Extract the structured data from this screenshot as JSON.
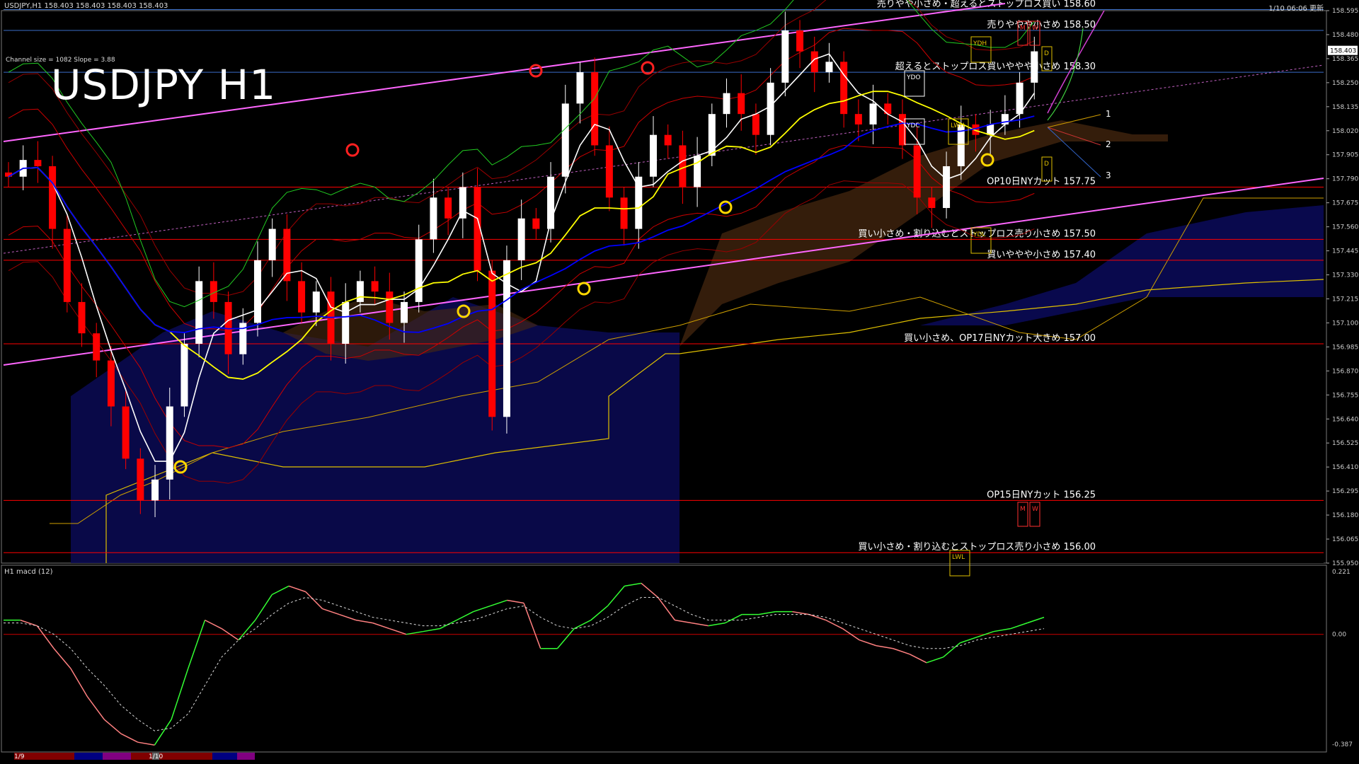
{
  "header": {
    "symbol_info": "USDJPY,H1  158.403 158.403 158.403 158.403",
    "update_time": "1/10 06:06 更新",
    "channel_info": "Channel size = 1082 Slope = 3.88",
    "title": "USDJPY H1",
    "macd_label": "H1  macd (12)"
  },
  "colors": {
    "background": "#000000",
    "bull_candle": "#ffffff",
    "bear_candle": "#ff0000",
    "channel": "#ff66ff",
    "ma_fast": "#ffffff",
    "ma_mid": "#ffff00",
    "ma_slow": "#0000ff",
    "macd_up": "#33ff33",
    "macd_down": "#ff8080",
    "level_line_red": "#ff0000",
    "level_line_blue": "#3a6ec8"
  },
  "chart_data": {
    "type": "candlestick",
    "symbol": "USDJPY",
    "timeframe": "H1",
    "ylim": [
      155.95,
      158.595
    ],
    "y_ticks": [
      "158.595",
      "158.480",
      "158.365",
      "158.250",
      "158.135",
      "158.020",
      "157.905",
      "157.790",
      "157.675",
      "157.560",
      "157.445",
      "157.330",
      "157.215",
      "157.100",
      "156.985",
      "156.870",
      "156.755",
      "156.640",
      "156.525",
      "156.410",
      "156.295",
      "156.180",
      "156.065",
      "155.950"
    ],
    "current_price": "158.403",
    "x_labels": [
      "1/9",
      "1/10"
    ],
    "levels": [
      {
        "price": 158.6,
        "label": "売りやや小さめ・超えるとストップロス買い 158.60",
        "line": "blue"
      },
      {
        "price": 158.5,
        "label": "売りややや小さめ 158.50",
        "line": "blue"
      },
      {
        "price": 158.3,
        "label": "超えるとストップロス買いややや小さめ 158.30",
        "line": "blue"
      },
      {
        "price": 157.75,
        "label": "OP10日NYカット 157.75",
        "line": "red"
      },
      {
        "price": 157.5,
        "label": "買い小さめ・割り込むとストップロス売り小さめ 157.50",
        "line": "red"
      },
      {
        "price": 157.4,
        "label": "買いややや小さめ 157.40",
        "line": "red"
      },
      {
        "price": 157.0,
        "label": "買い小さめ、OP17日NYカット大きめ 157.00",
        "line": "red"
      },
      {
        "price": 156.25,
        "label": "OP15日NYカット 156.25",
        "line": "red"
      },
      {
        "price": 156.0,
        "label": "買い小さめ・割り込むとストップロス売り小さめ 156.00",
        "line": "red"
      }
    ],
    "markers": [
      "YDH",
      "YDO",
      "YDC",
      "LWH",
      "YDL",
      "LWL",
      "M",
      "W",
      "D"
    ],
    "projection_labels": [
      "1",
      "2",
      "3"
    ],
    "close_path": [
      157.8,
      157.88,
      157.85,
      157.55,
      157.2,
      157.05,
      156.92,
      156.7,
      156.45,
      156.25,
      156.35,
      156.7,
      157.0,
      157.3,
      157.2,
      156.95,
      157.1,
      157.4,
      157.55,
      157.3,
      157.15,
      157.25,
      157.0,
      157.2,
      157.3,
      157.25,
      157.1,
      157.2,
      157.5,
      157.7,
      157.6,
      157.75,
      157.35,
      156.65,
      157.4,
      157.6,
      157.55,
      157.8,
      158.15,
      158.3,
      157.95,
      157.7,
      157.55,
      157.8,
      158.0,
      157.95,
      157.75,
      157.9,
      158.1,
      158.2,
      158.1,
      158.0,
      158.25,
      158.5,
      158.4,
      158.3,
      158.35,
      158.1,
      158.05,
      158.15,
      158.1,
      157.95,
      157.7,
      157.65,
      157.85,
      158.05,
      158.0,
      158.05,
      158.1,
      158.25,
      158.4
    ],
    "macd": {
      "ylim": [
        -0.387,
        0.221
      ],
      "y_ticks": [
        "0.221",
        "0.00",
        "-0.387"
      ],
      "values": [
        0.05,
        0.05,
        0.03,
        -0.05,
        -0.12,
        -0.22,
        -0.3,
        -0.35,
        -0.38,
        -0.39,
        -0.3,
        -0.12,
        0.05,
        0.02,
        -0.02,
        0.05,
        0.14,
        0.17,
        0.15,
        0.09,
        0.07,
        0.05,
        0.04,
        0.02,
        0.0,
        0.01,
        0.02,
        0.05,
        0.08,
        0.1,
        0.12,
        0.11,
        -0.05,
        -0.05,
        0.02,
        0.05,
        0.1,
        0.17,
        0.18,
        0.13,
        0.05,
        0.04,
        0.03,
        0.04,
        0.07,
        0.07,
        0.08,
        0.08,
        0.07,
        0.05,
        0.02,
        -0.02,
        -0.04,
        -0.05,
        -0.07,
        -0.1,
        -0.08,
        -0.03,
        -0.01,
        0.01,
        0.02,
        0.04,
        0.06
      ],
      "signal": [
        0.04,
        0.04,
        0.03,
        0.0,
        -0.05,
        -0.12,
        -0.18,
        -0.25,
        -0.3,
        -0.34,
        -0.33,
        -0.28,
        -0.18,
        -0.08,
        -0.02,
        0.02,
        0.07,
        0.11,
        0.13,
        0.12,
        0.1,
        0.08,
        0.06,
        0.05,
        0.04,
        0.03,
        0.03,
        0.04,
        0.05,
        0.07,
        0.09,
        0.1,
        0.06,
        0.03,
        0.02,
        0.03,
        0.06,
        0.1,
        0.13,
        0.13,
        0.1,
        0.07,
        0.05,
        0.05,
        0.05,
        0.06,
        0.07,
        0.07,
        0.07,
        0.06,
        0.04,
        0.02,
        0.0,
        -0.02,
        -0.04,
        -0.05,
        -0.05,
        -0.04,
        -0.02,
        -0.01,
        0.0,
        0.01,
        0.02
      ]
    }
  }
}
